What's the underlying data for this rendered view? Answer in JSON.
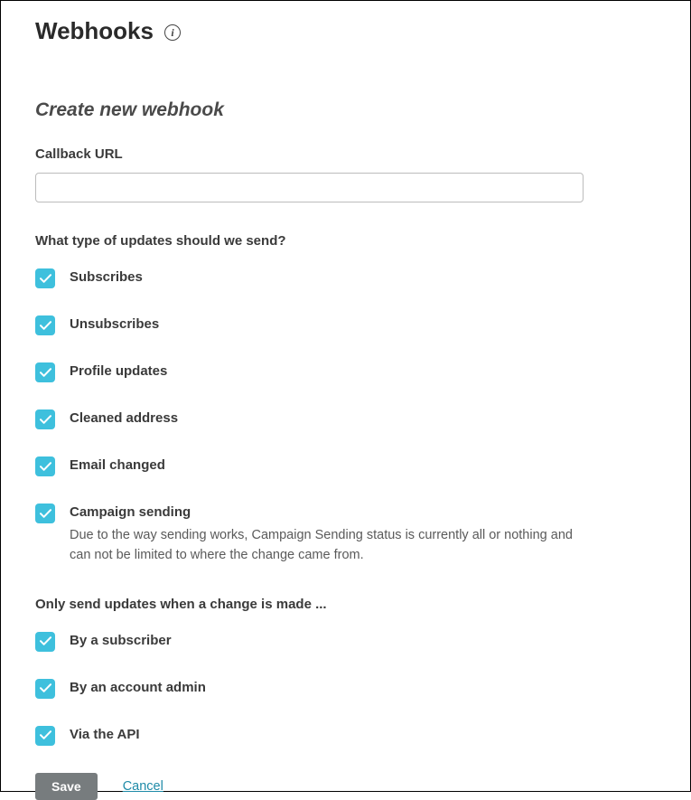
{
  "header": {
    "title": "Webhooks"
  },
  "section": {
    "heading": "Create new webhook"
  },
  "callback": {
    "label": "Callback URL",
    "value": ""
  },
  "updates": {
    "group_label": "What type of updates should we send?",
    "items": [
      {
        "label": "Subscribes"
      },
      {
        "label": "Unsubscribes"
      },
      {
        "label": "Profile updates"
      },
      {
        "label": "Cleaned address"
      },
      {
        "label": "Email changed"
      },
      {
        "label": "Campaign sending",
        "note": "Due to the way sending works, Campaign Sending status is currently all or nothing and can not be limited to where the change came from."
      }
    ]
  },
  "sources": {
    "group_label": "Only send updates when a change is made ...",
    "items": [
      {
        "label": "By a subscriber"
      },
      {
        "label": "By an account admin"
      },
      {
        "label": "Via the API"
      }
    ]
  },
  "actions": {
    "save": "Save",
    "cancel": "Cancel"
  }
}
